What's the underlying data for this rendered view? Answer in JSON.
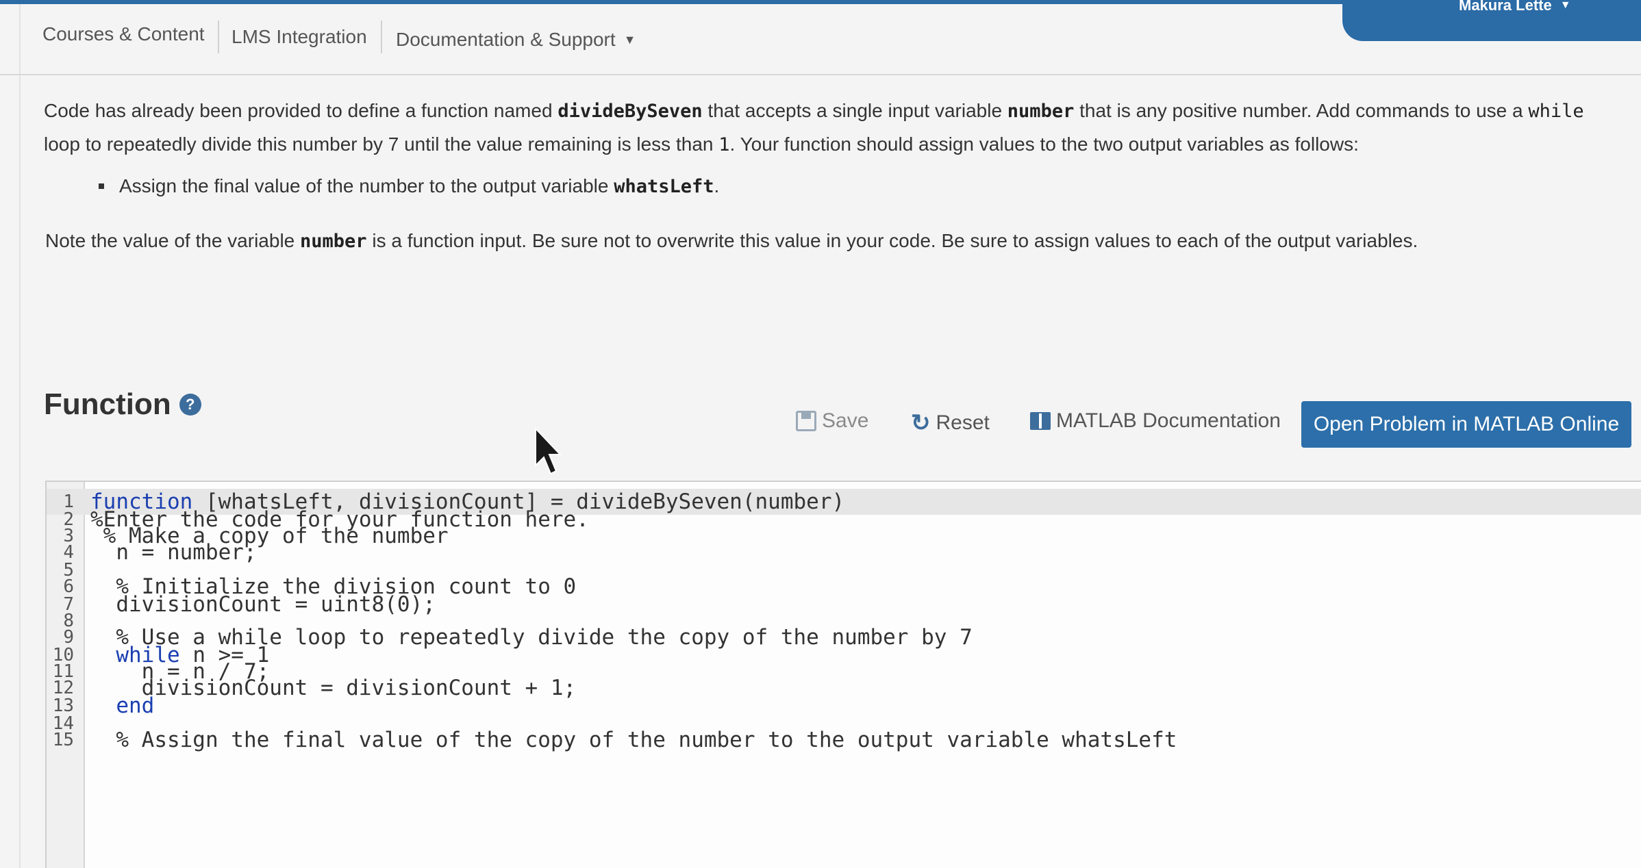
{
  "header": {
    "user_name": "Makura Lette",
    "nav": [
      {
        "label": "Courses & Content"
      },
      {
        "label": "LMS Integration"
      },
      {
        "label": "Documentation & Support"
      }
    ]
  },
  "description": {
    "p1_a": "Code has already been provided to define a function named ",
    "p1_fn": "divideBySeven",
    "p1_b": " that accepts a single input variable ",
    "p1_var": "number",
    "p1_c": " that is any positive number. Add commands to use a ",
    "p1_while": "while",
    "p1_d": " loop to repeatedly divide this number by 7 until the value remaining is less than ",
    "p1_one": "1",
    "p1_e": ". Your function should assign values to the two output variables as follows:",
    "bullet_a": "Assign the final value of the number to the output variable ",
    "bullet_var": "whatsLeft",
    "bullet_b": ".",
    "note_a": "Note the value of the variable ",
    "note_var": "number",
    "note_b": " is a function input. Be sure not to overwrite this value in your code. Be sure to assign values to each of the output variables."
  },
  "function_section": {
    "title": "Function",
    "help_icon": "?",
    "save_label": "Save",
    "reset_label": "Reset",
    "docs_label": "MATLAB Documentation",
    "open_label": "Open Problem in MATLAB Online"
  },
  "code_lines": [
    {
      "num": "1",
      "kw": "function",
      "text": " [whatsLeft, divisionCount] = divideBySeven(number)"
    },
    {
      "num": "2",
      "text": "%Enter the code for your function here."
    },
    {
      "num": "3",
      "text": " % Make a copy of the number"
    },
    {
      "num": "4",
      "text": "  n = number;"
    },
    {
      "num": "5",
      "text": ""
    },
    {
      "num": "6",
      "text": "  % Initialize the division count to 0"
    },
    {
      "num": "7",
      "text": "  divisionCount = uint8(0);"
    },
    {
      "num": "8",
      "text": ""
    },
    {
      "num": "9",
      "text": "  % Use a while loop to repeatedly divide the copy of the number by 7"
    },
    {
      "num": "10",
      "pre": "  ",
      "kw": "while",
      "text": " n >= 1"
    },
    {
      "num": "11",
      "text": "    n = n / 7;"
    },
    {
      "num": "12",
      "text": "    divisionCount = divisionCount + 1;"
    },
    {
      "num": "13",
      "pre": "  ",
      "kw": "end",
      "text": ""
    },
    {
      "num": "14",
      "text": ""
    },
    {
      "num": "15",
      "text": "  % Assign the final value of the copy of the number to the output variable whatsLeft"
    }
  ],
  "colors": {
    "brand_blue": "#2c6faa",
    "keyword": "#1a3fb0"
  },
  "icons": [
    "chevron-down-icon",
    "help-icon",
    "save-icon",
    "reset-icon",
    "docs-icon",
    "cursor-icon"
  ]
}
